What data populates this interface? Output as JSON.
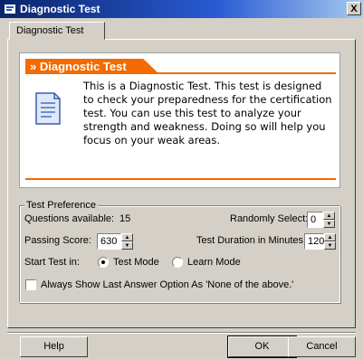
{
  "window": {
    "title": "Diagnostic Test",
    "close_label": "X"
  },
  "tabs": [
    {
      "label": "Diagnostic Test"
    }
  ],
  "info": {
    "heading": "» Diagnostic Test",
    "description": "This is a Diagnostic Test. This test is designed to check your preparedness for the certification test. You can use this test to analyze your strength and weakness. Doing so will help you focus on your weak areas."
  },
  "preferences": {
    "legend": "Test Preference",
    "questions_available_label": "Questions available:",
    "questions_available_value": "15",
    "randomly_select_label": "Randomly Select:",
    "randomly_select_value": "0",
    "passing_score_label": "Passing Score:",
    "passing_score_value": "630",
    "duration_label": "Test Duration in Minutes:",
    "duration_value": "120",
    "start_test_label": "Start Test in:",
    "modes": [
      {
        "label": "Test Mode",
        "selected": true
      },
      {
        "label": "Learn Mode",
        "selected": false
      }
    ],
    "always_show_label": "Always Show Last Answer Option As 'None of the above.'",
    "always_show_checked": false
  },
  "buttons": {
    "help": "Help",
    "ok": "OK",
    "cancel": "Cancel"
  },
  "colors": {
    "accent": "#f26a00",
    "titlebar": "#0a246a",
    "face": "#d4d0c8"
  },
  "icons": {
    "app": "app-icon",
    "document": "document-icon",
    "spin_up": "up-arrow-icon",
    "spin_down": "down-arrow-icon"
  }
}
